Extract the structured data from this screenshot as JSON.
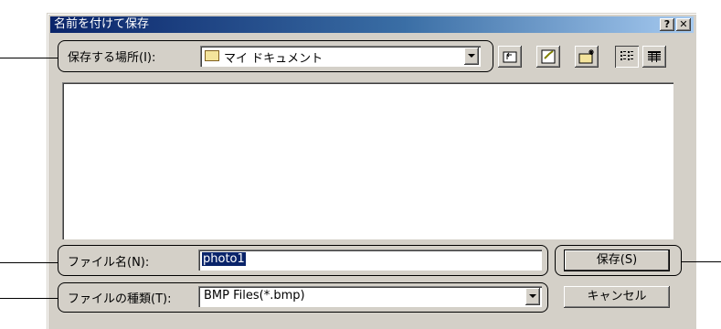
{
  "window": {
    "title": "名前を付けて保存",
    "help_label": "?",
    "close_label": "✕"
  },
  "save_in": {
    "label": "保存する場所(I):",
    "value": "マイ ドキュメント",
    "icon": "folder-icon"
  },
  "toolbar": {
    "icons": [
      "up-folder-icon",
      "desktop-icon",
      "new-folder-icon",
      "list-view-icon",
      "details-view-icon"
    ]
  },
  "file_name": {
    "label": "ファイル名(N):",
    "value": "photo1"
  },
  "file_type": {
    "label": "ファイルの種類(T):",
    "value": "BMP Files(*.bmp)"
  },
  "buttons": {
    "save": "保存(S)",
    "cancel": "キャンセル"
  }
}
